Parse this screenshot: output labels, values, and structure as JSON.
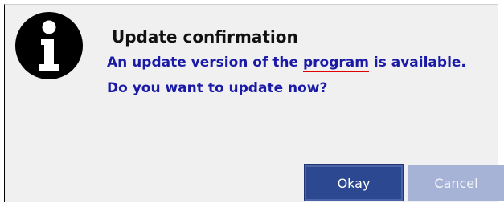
{
  "dialog": {
    "icon": "info-icon",
    "title": "Update confirmation",
    "message_line1_before": "An update version of the ",
    "message_line1_highlight": "program",
    "message_line1_after": " is available.",
    "message_line2": "Do you want to update now?"
  },
  "buttons": {
    "okay_label": "Okay",
    "cancel_label": "Cancel"
  },
  "colors": {
    "message_text": "#1a1aa6",
    "okay_button": "#2c4890",
    "cancel_button": "#a6b3d6",
    "spellcheck_underline": "#e00000"
  }
}
